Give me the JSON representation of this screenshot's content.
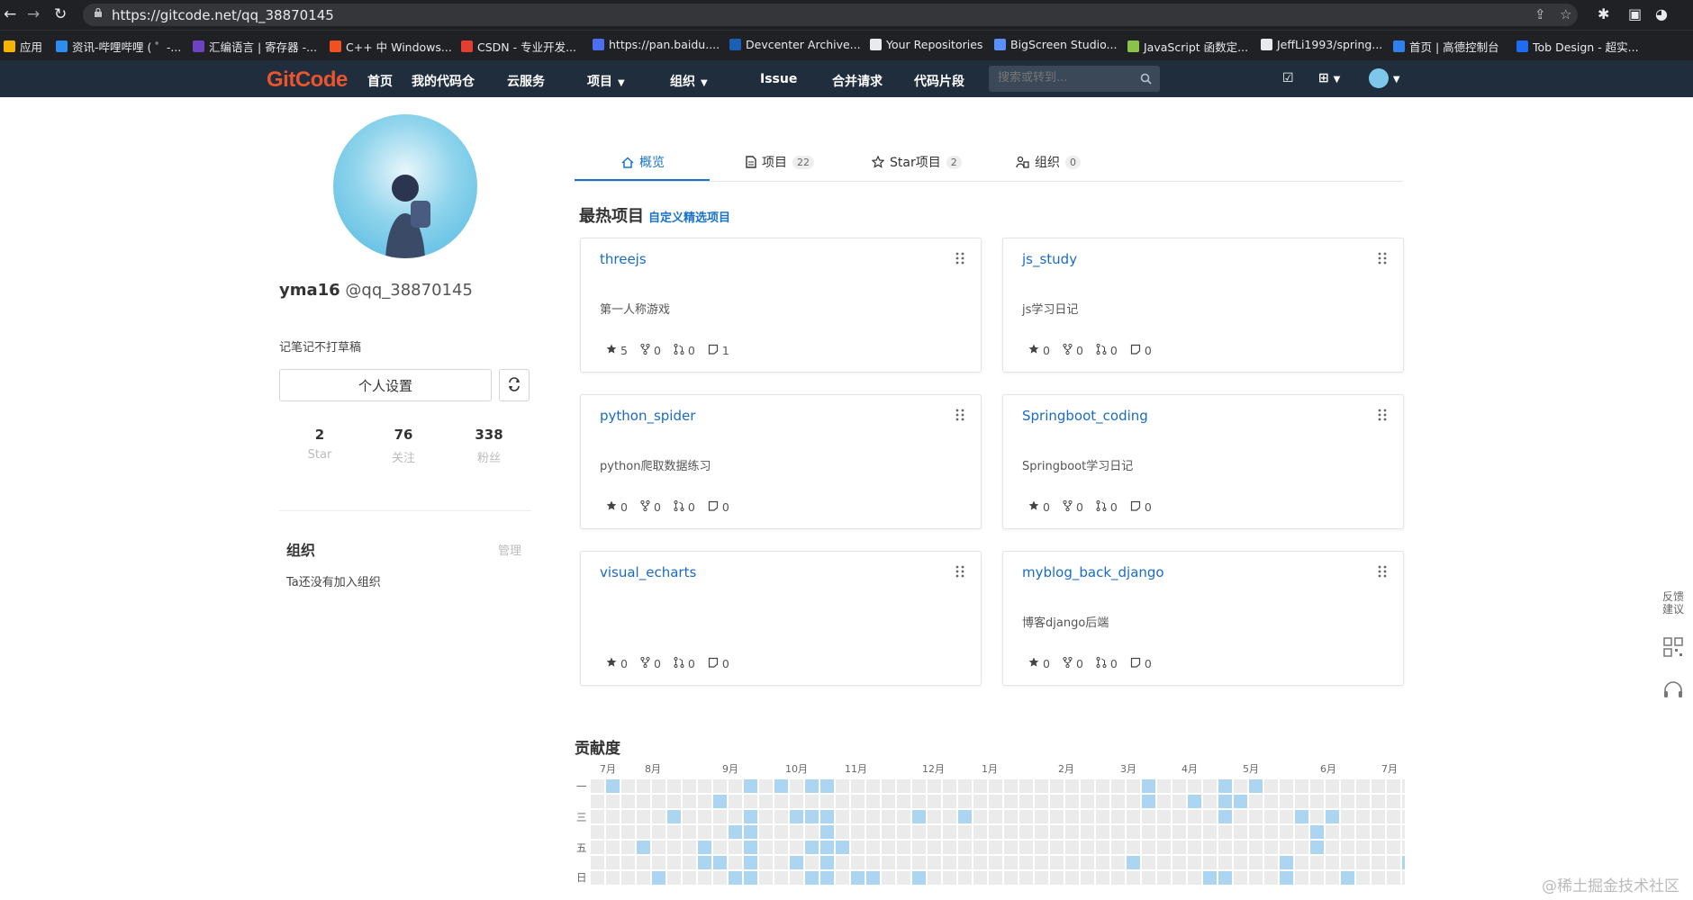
{
  "browser": {
    "url": "https://gitcode.net/qq_38870145",
    "bookmarks": [
      {
        "label": "应用",
        "color": "#f4b400"
      },
      {
        "label": "资讯-哔哩哔哩 ( ゜-...",
        "color": "#2d8cf0"
      },
      {
        "label": "汇编语言 | 寄存器 -...",
        "color": "#6f42c1"
      },
      {
        "label": "C++ 中 Windows...",
        "color": "#f25022"
      },
      {
        "label": "CSDN - 专业开发...",
        "color": "#e33e33"
      },
      {
        "label": "https://pan.baidu....",
        "color": "#4e6ef2"
      },
      {
        "label": "Devcenter Archive...",
        "color": "#1a5fb4"
      },
      {
        "label": "Your Repositories",
        "color": "#e8eaed"
      },
      {
        "label": "BigScreen Studio...",
        "color": "#5b8ff9"
      },
      {
        "label": "JavaScript 函数定...",
        "color": "#8bc34a"
      },
      {
        "label": "JeffLi1993/spring...",
        "color": "#e8eaed"
      },
      {
        "label": "首页 | 高德控制台",
        "color": "#2f80ed"
      },
      {
        "label": "Tob Design - 超实...",
        "color": "#1d6cf2"
      }
    ]
  },
  "nav": {
    "logo": "GitCode",
    "links": [
      "首页",
      "我的代码仓",
      "云服务",
      "项目",
      "组织",
      "Issue",
      "合并请求",
      "代码片段"
    ],
    "search_placeholder": "搜索或转到..."
  },
  "profile": {
    "display_name": "yma16",
    "username": "@qq_38870145",
    "bio": "记笔记不打草稿",
    "settings_button": "个人设置",
    "stats": [
      {
        "value": "2",
        "label": "Star"
      },
      {
        "value": "76",
        "label": "关注"
      },
      {
        "value": "338",
        "label": "粉丝"
      }
    ],
    "org_title": "组织",
    "org_manage": "管理",
    "org_empty": "Ta还没有加入组织"
  },
  "tabs": [
    {
      "label": "概览",
      "count": ""
    },
    {
      "label": "项目",
      "count": "22"
    },
    {
      "label": "Star项目",
      "count": "2"
    },
    {
      "label": "组织",
      "count": "0"
    }
  ],
  "featured": {
    "title": "最热项目",
    "custom_link": "自定义精选项目",
    "projects": [
      {
        "name": "threejs",
        "desc": "第一人称游戏",
        "stars": "5",
        "forks": "0",
        "mrs": "0",
        "issues": "1"
      },
      {
        "name": "js_study",
        "desc": "js学习日记",
        "stars": "0",
        "forks": "0",
        "mrs": "0",
        "issues": "0"
      },
      {
        "name": "python_spider",
        "desc": "python爬取数据练习",
        "stars": "0",
        "forks": "0",
        "mrs": "0",
        "issues": "0"
      },
      {
        "name": "Springboot_coding",
        "desc": "Springboot学习日记",
        "stars": "0",
        "forks": "0",
        "mrs": "0",
        "issues": "0"
      },
      {
        "name": "visual_echarts",
        "desc": "",
        "stars": "0",
        "forks": "0",
        "mrs": "0",
        "issues": "0"
      },
      {
        "name": "myblog_back_django",
        "desc": "博客django后端",
        "stars": "0",
        "forks": "0",
        "mrs": "0",
        "issues": "0"
      }
    ]
  },
  "contributions": {
    "title": "贡献度",
    "months": [
      "7月",
      "8月",
      "9月",
      "10月",
      "11月",
      "12月",
      "1月",
      "2月",
      "3月",
      "4月",
      "5月",
      "6月",
      "7月"
    ],
    "day_labels": [
      "一",
      "三",
      "五",
      "日"
    ],
    "colors": {
      "empty": "#ebebeb",
      "active": "#acd5f2"
    },
    "active_cells": [
      [
        1,
        0
      ],
      [
        3,
        4
      ],
      [
        4,
        6
      ],
      [
        5,
        2
      ],
      [
        7,
        4
      ],
      [
        7,
        5
      ],
      [
        8,
        1
      ],
      [
        8,
        5
      ],
      [
        9,
        3
      ],
      [
        9,
        6
      ],
      [
        10,
        0
      ],
      [
        10,
        2
      ],
      [
        10,
        3
      ],
      [
        10,
        4
      ],
      [
        10,
        5
      ],
      [
        10,
        6
      ],
      [
        12,
        0
      ],
      [
        13,
        2
      ],
      [
        13,
        5
      ],
      [
        14,
        0
      ],
      [
        14,
        2
      ],
      [
        14,
        4
      ],
      [
        14,
        6
      ],
      [
        15,
        0
      ],
      [
        15,
        2
      ],
      [
        15,
        3
      ],
      [
        15,
        4
      ],
      [
        15,
        5
      ],
      [
        15,
        6
      ],
      [
        16,
        4
      ],
      [
        17,
        6
      ],
      [
        18,
        6
      ],
      [
        21,
        2
      ],
      [
        21,
        6
      ],
      [
        24,
        2
      ],
      [
        35,
        5
      ],
      [
        36,
        0
      ],
      [
        36,
        1
      ],
      [
        39,
        1
      ],
      [
        40,
        6
      ],
      [
        41,
        0
      ],
      [
        41,
        1
      ],
      [
        41,
        2
      ],
      [
        41,
        6
      ],
      [
        42,
        1
      ],
      [
        43,
        0
      ],
      [
        45,
        5
      ],
      [
        45,
        6
      ],
      [
        46,
        2
      ],
      [
        47,
        3
      ],
      [
        47,
        4
      ],
      [
        48,
        2
      ],
      [
        49,
        6
      ],
      [
        53,
        5
      ]
    ]
  },
  "side": {
    "feedback": "反馈建议"
  },
  "watermark": "@稀土掘金技术社区"
}
